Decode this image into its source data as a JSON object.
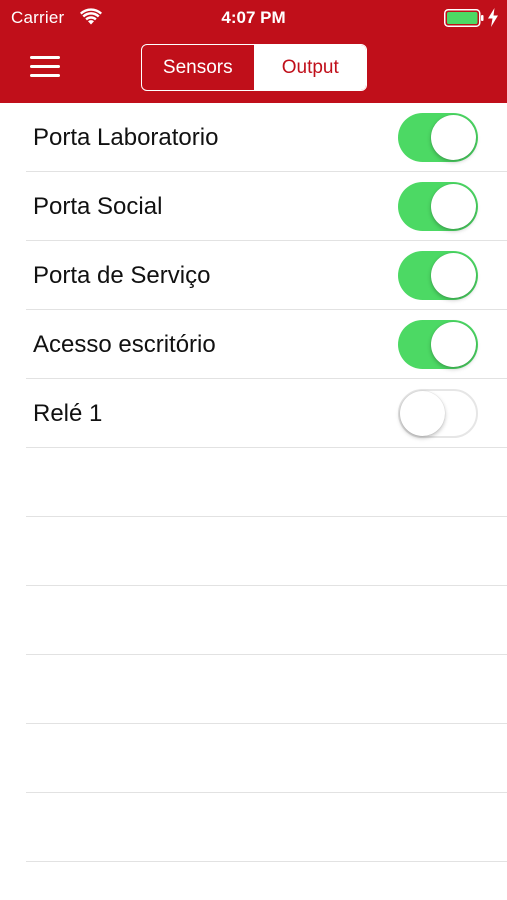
{
  "status_bar": {
    "carrier": "Carrier",
    "time": "4:07 PM",
    "wifi_icon": "wifi-icon",
    "battery_icon": "battery-icon",
    "charging_icon": "charging-bolt-icon"
  },
  "nav": {
    "menu_icon": "hamburger-menu-icon",
    "segments": [
      {
        "label": "Sensors",
        "selected": false
      },
      {
        "label": "Output",
        "selected": true
      }
    ]
  },
  "outputs": [
    {
      "label": "Porta Laboratorio",
      "on": true
    },
    {
      "label": "Porta Social",
      "on": true
    },
    {
      "label": "Porta de Serviço",
      "on": true
    },
    {
      "label": "Acesso escritório",
      "on": true
    },
    {
      "label": "Relé 1",
      "on": false
    }
  ],
  "colors": {
    "header": "#c00f1a",
    "toggle_on": "#4cd964",
    "separator": "#e2e2e2"
  }
}
